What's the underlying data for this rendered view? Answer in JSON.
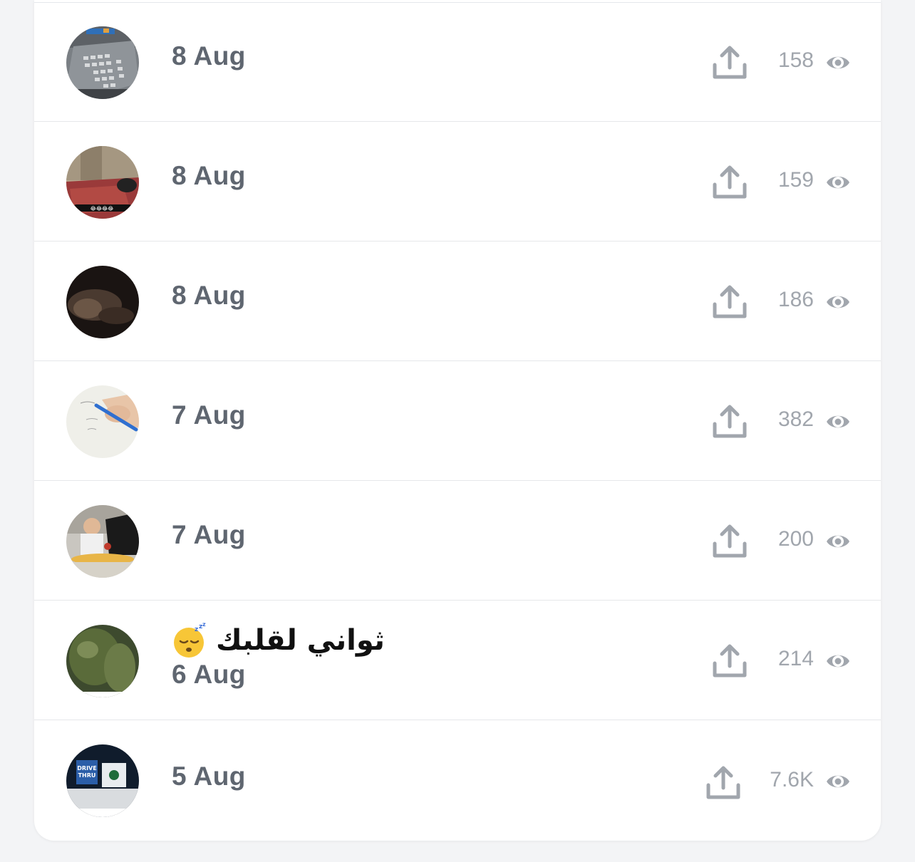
{
  "accent": {
    "text_dark": "#111111",
    "date_gray": "#5f6670",
    "icon_gray": "#a1a6ad",
    "divider": "#e6e7ea"
  },
  "posts": [
    {
      "thumbnail": "keypad-thumbnail",
      "date": "8 Aug",
      "views": "158",
      "share_icon": "upload-icon",
      "view_icon": "eye-icon"
    },
    {
      "thumbnail": "room-rug-thumbnail",
      "date": "8 Aug",
      "views": "159",
      "share_icon": "upload-icon",
      "view_icon": "eye-icon"
    },
    {
      "thumbnail": "dark-scene-thumbnail",
      "date": "8 Aug",
      "views": "186",
      "share_icon": "upload-icon",
      "view_icon": "eye-icon"
    },
    {
      "thumbnail": "handwriting-thumbnail",
      "date": "7 Aug",
      "views": "382",
      "share_icon": "upload-icon",
      "view_icon": "eye-icon"
    },
    {
      "thumbnail": "people-food-thumbnail",
      "date": "7 Aug",
      "views": "200",
      "share_icon": "upload-icon",
      "view_icon": "eye-icon"
    },
    {
      "thumbnail": "mossy-rock-thumbnail",
      "caption": "ثواني لقلبك",
      "caption_emoji": "sleeping-face-icon",
      "date": "6 Aug",
      "views": "214",
      "share_icon": "upload-icon",
      "view_icon": "eye-icon"
    },
    {
      "thumbnail": "drive-thru-thumbnail",
      "date": "5 Aug",
      "views": "7.6K",
      "share_icon": "upload-icon",
      "view_icon": "eye-icon"
    }
  ]
}
